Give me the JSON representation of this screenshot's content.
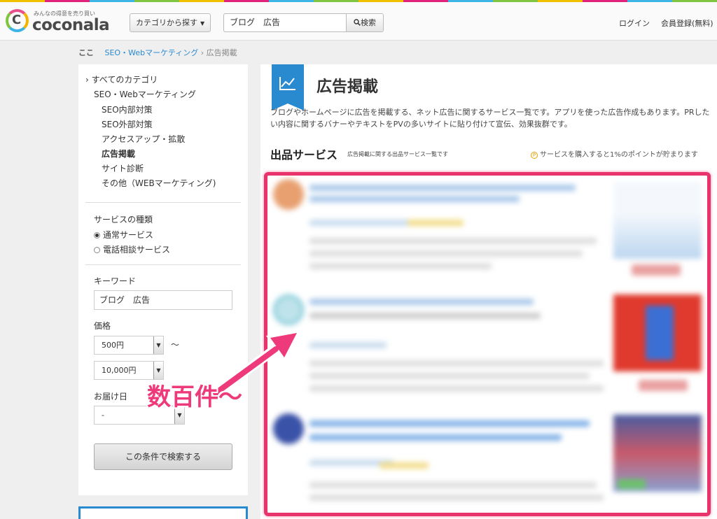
{
  "colors": {
    "accent_pink": "#e8336c",
    "link_blue": "#2a8ad0",
    "category_blue": "#2a8ad0"
  },
  "header": {
    "logo_tagline": "みんなの得意を売り買い",
    "logo_text": "coconala",
    "logo_mark": "C",
    "category_button": "カテゴリから探す",
    "search_value": "ブログ　広告",
    "search_button": "検索",
    "login": "ログイン",
    "register": "会員登録(無料)"
  },
  "breadcrumb": {
    "home": "ここ",
    "parent": "SEO・Webマーケティング",
    "separator": "›",
    "current": "広告掲載"
  },
  "sidebar": {
    "all_categories": "すべてのカテゴリ",
    "parent_category": "SEO・Webマーケティング",
    "children": [
      {
        "label": "SEO内部対策",
        "active": false
      },
      {
        "label": "SEO外部対策",
        "active": false
      },
      {
        "label": "アクセスアップ・拡散",
        "active": false
      },
      {
        "label": "広告掲載",
        "active": true
      },
      {
        "label": "サイト診断",
        "active": false
      },
      {
        "label": "その他（WEBマーケティング)",
        "active": false
      }
    ],
    "service_type_label": "サービスの種類",
    "service_types": [
      {
        "label": "通常サービス",
        "selected": true
      },
      {
        "label": "電話相談サービス",
        "selected": false
      }
    ],
    "keyword_label": "キーワード",
    "keyword_value": "ブログ　広告",
    "price_label": "価格",
    "price_min": "500円",
    "price_separator": "〜",
    "price_max": "10,000円",
    "delivery_label": "お届け日",
    "delivery_value": "-",
    "search_button": "この条件で検索する"
  },
  "main": {
    "title": "広告掲載",
    "description": "ブログやホームページに広告を掲載する、ネット広告に関するサービス一覧です。アプリを使った広告作成もあります。PRしたい内容に関するバナーやテキストをPVの多いサイトに貼り付けて宣伝、効果抜群です。",
    "services_heading": "出品サービス",
    "services_sub": "広告掲載に関する出品サービス一覧です",
    "points_icon": "P",
    "points_note": "サービスを購入すると1%のポイントが貯まります"
  },
  "annotation": {
    "text": "数百件〜"
  },
  "icons": {
    "search": "search-icon",
    "caret": "caret-down-icon",
    "chart": "line-chart-icon",
    "home": "home-icon"
  }
}
